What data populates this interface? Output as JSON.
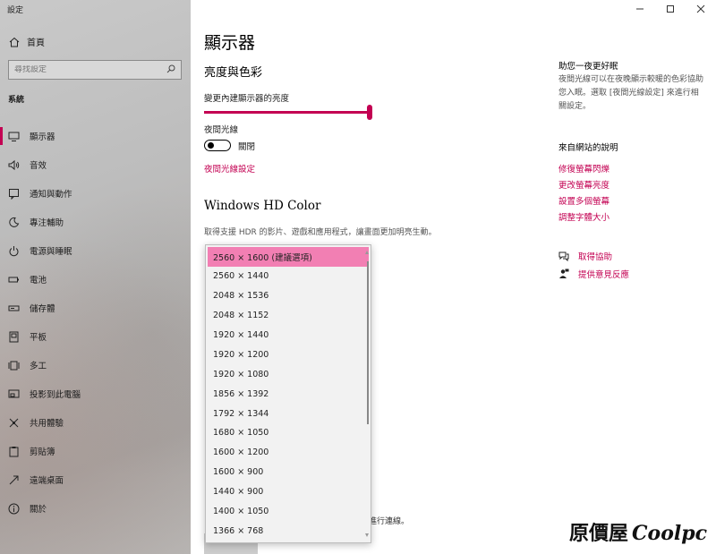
{
  "window": {
    "title": "設定"
  },
  "sidebar": {
    "home_label": "首頁",
    "search_placeholder": "尋找設定",
    "section": "系統",
    "items": [
      {
        "label": "顯示器",
        "icon": "monitor-icon"
      },
      {
        "label": "音效",
        "icon": "speaker-icon"
      },
      {
        "label": "通知與動作",
        "icon": "notification-icon"
      },
      {
        "label": "專注輔助",
        "icon": "moon-icon"
      },
      {
        "label": "電源與睡眠",
        "icon": "power-icon"
      },
      {
        "label": "電池",
        "icon": "battery-icon"
      },
      {
        "label": "儲存體",
        "icon": "storage-icon"
      },
      {
        "label": "平板",
        "icon": "tablet-icon"
      },
      {
        "label": "多工",
        "icon": "multitask-icon"
      },
      {
        "label": "投影到此電腦",
        "icon": "project-icon"
      },
      {
        "label": "共用體驗",
        "icon": "shared-experience-icon"
      },
      {
        "label": "剪貼簿",
        "icon": "clipboard-icon"
      },
      {
        "label": "遠端桌面",
        "icon": "remote-desktop-icon"
      },
      {
        "label": "關於",
        "icon": "info-icon"
      }
    ]
  },
  "main": {
    "title": "顯示器",
    "brightness_heading": "亮度與色彩",
    "brightness_label": "變更內建顯示器的亮度",
    "brightness_value": 1.0,
    "night_light_label": "夜間光線",
    "night_light_state": "關閉",
    "night_light_link": "夜間光線設定",
    "hdr_heading": "Windows HD Color",
    "hdr_desc": "取得支援 HDR 的影片、遊戲和應用程式，讓畫面更加明亮生動。",
    "tail_text": "以嘗試進行連線。"
  },
  "resolution_dropdown": {
    "options": [
      "2560 × 1600 (建議選項)",
      "2560 × 1440",
      "2048 × 1536",
      "2048 × 1152",
      "1920 × 1440",
      "1920 × 1200",
      "1920 × 1080",
      "1856 × 1392",
      "1792 × 1344",
      "1680 × 1050",
      "1600 × 1200",
      "1600 × 900",
      "1440 × 900",
      "1400 × 1050",
      "1366 × 768"
    ],
    "selected_index": 0
  },
  "right_panel": {
    "night_title": "助您一夜更好眠",
    "night_desc": "夜間光線可以在夜晚顯示較暖的色彩協助您入眠。選取 [夜間光線設定] 來進行相關設定。",
    "web_help_title": "來自網站的說明",
    "web_links": [
      "修復螢幕閃爍",
      "更改螢幕亮度",
      "設置多個螢幕",
      "調整字體大小"
    ],
    "get_help": "取得協助",
    "feedback": "提供意見反應"
  },
  "watermark": {
    "text": "原價屋",
    "brand": "Coolpc"
  },
  "colors": {
    "accent": "#c30052",
    "selected_option": "#f27fb3"
  }
}
